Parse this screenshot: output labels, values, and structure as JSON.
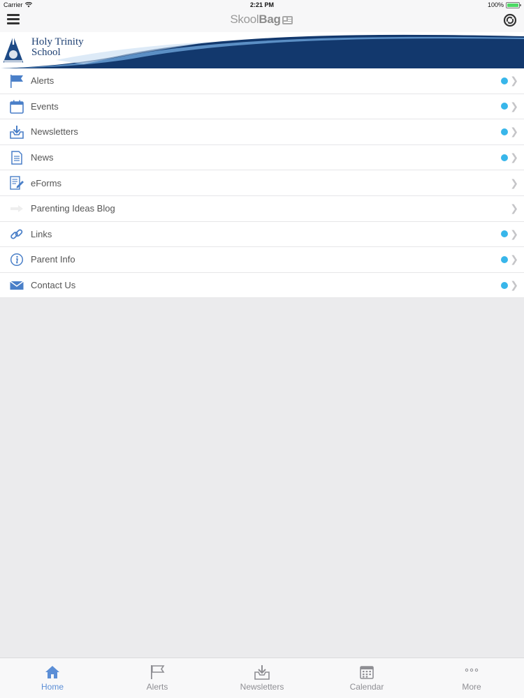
{
  "status_bar": {
    "carrier": "Carrier",
    "time": "2:21 PM",
    "battery": "100%"
  },
  "nav": {
    "brand_light": "Skool",
    "brand_bold": "Bag"
  },
  "banner": {
    "school_line1": "Holy Trinity",
    "school_line2": "School"
  },
  "colors": {
    "accent": "#38b6ea",
    "banner": "#12386d",
    "icon_blue": "#4a7fc8",
    "active_tab": "#5b8ed6"
  },
  "menu": {
    "items": [
      {
        "label": "Alerts",
        "icon": "flag-icon",
        "badge": true
      },
      {
        "label": "Events",
        "icon": "calendar-icon",
        "badge": true
      },
      {
        "label": "Newsletters",
        "icon": "download-tray-icon",
        "badge": true
      },
      {
        "label": "News",
        "icon": "document-icon",
        "badge": true
      },
      {
        "label": "eForms",
        "icon": "form-pencil-icon",
        "badge": false
      },
      {
        "label": "Parenting Ideas Blog",
        "icon": "arrow-icon",
        "badge": false
      },
      {
        "label": "Links",
        "icon": "link-icon",
        "badge": true
      },
      {
        "label": "Parent Info",
        "icon": "info-icon",
        "badge": true
      },
      {
        "label": "Contact Us",
        "icon": "envelope-icon",
        "badge": true
      }
    ]
  },
  "tabs": [
    {
      "label": "Home",
      "icon": "home-icon",
      "active": true
    },
    {
      "label": "Alerts",
      "icon": "flag-icon",
      "active": false
    },
    {
      "label": "Newsletters",
      "icon": "download-tray-icon",
      "active": false
    },
    {
      "label": "Calendar",
      "icon": "calendar-icon",
      "active": false
    },
    {
      "label": "More",
      "icon": "more-dots-icon",
      "active": false
    }
  ]
}
